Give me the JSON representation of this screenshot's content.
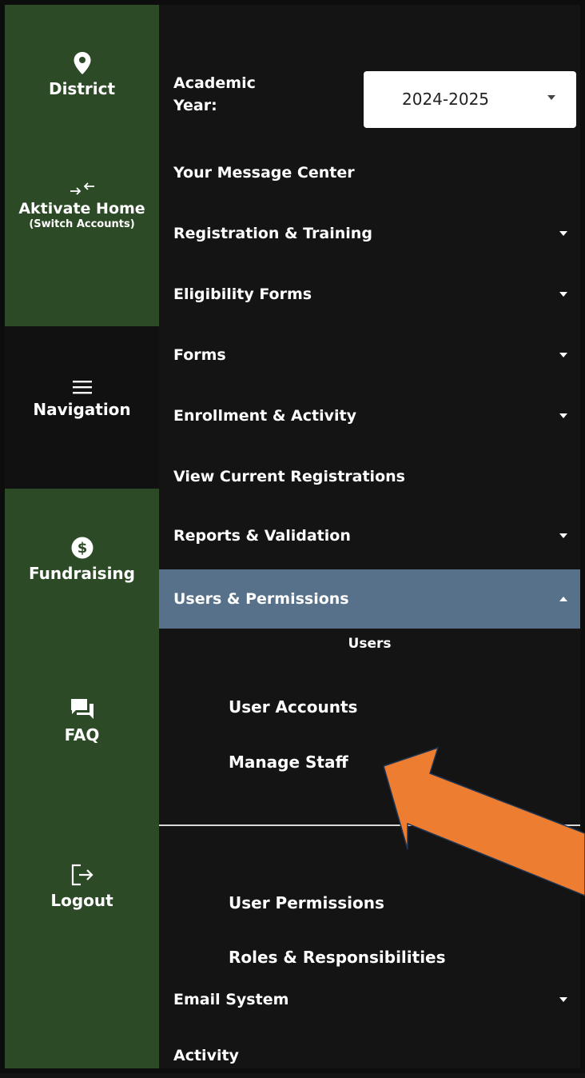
{
  "rail": {
    "district": {
      "label": "District",
      "icon": "map-pin-icon"
    },
    "home": {
      "label": "Aktivate Home",
      "sublabel": "(Switch Accounts)",
      "icon": "switch-arrows-icon"
    },
    "navigation": {
      "label": "Navigation",
      "icon": "hamburger-menu-icon"
    },
    "fundraising": {
      "label": "Fundraising",
      "icon": "dollar-circle-icon"
    },
    "faq": {
      "label": "FAQ",
      "icon": "chat-bubbles-icon"
    },
    "logout": {
      "label": "Logout",
      "icon": "logout-icon"
    }
  },
  "academic_year": {
    "label": "Academic Year:",
    "value": "2024-2025"
  },
  "menu": {
    "message_center": "Your Message Center",
    "registration_training": "Registration & Training",
    "eligibility_forms": "Eligibility Forms",
    "forms": "Forms",
    "enrollment_activity": "Enrollment & Activity",
    "view_current_registrations": "View Current Registrations",
    "reports_validation": "Reports & Validation",
    "users_permissions": "Users & Permissions",
    "email_system": "Email System",
    "activity": "Activity"
  },
  "users_submenu": {
    "heading": "Users",
    "user_accounts": "User Accounts",
    "manage_staff": "Manage Staff",
    "user_permissions": "User Permissions",
    "roles_responsibilities": "Roles & Responsibilities"
  },
  "colors": {
    "rail_green": "#2c4a26",
    "active_item": "#567189",
    "annotation_arrow": "#ed7d31"
  }
}
